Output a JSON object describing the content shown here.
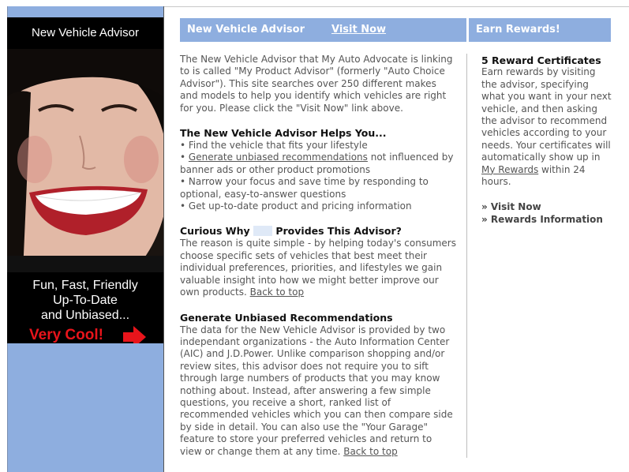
{
  "promo": {
    "title": "New Vehicle Advisor",
    "tagline_1": "Fun, Fast, Friendly",
    "tagline_2": "Up-To-Date",
    "tagline_3": "and Unbiased...",
    "cool": "Very Cool!"
  },
  "header": {
    "main_title": "New Vehicle Advisor",
    "visit_now": "Visit Now",
    "side_title": "Earn Rewards!"
  },
  "intro": "The New Vehicle Advisor that My Auto Advocate is linking to is called \"My Product Advisor\" (formerly \"Auto Choice Advisor\"). This site searches over 250 different makes and models to help you identify which vehicles are right for you. Please click the \"Visit Now\" link above.",
  "helps": {
    "heading": "The New Vehicle Advisor Helps You...",
    "b1": "• Find the vehicle that fits your lifestyle",
    "b2_prefix": "• ",
    "b2_link": "Generate unbiased recommendations",
    "b2_rest": " not influenced by banner ads or other product promotions",
    "b3": "• Narrow your focus and save time by responding to optional, easy-to-answer questions",
    "b4": "• Get up-to-date product and pricing information"
  },
  "curious": {
    "heading_a": "Curious Why",
    "heading_b": "Provides This Advisor?",
    "body": "The reason is quite simple - by helping today's consumers choose specific sets of vehicles that best meet their individual preferences, priorities, and lifestyles we gain valuable insight into how we might better improve our own products.",
    "back": "Back to top"
  },
  "generate": {
    "heading": "Generate Unbiased Recommendations",
    "body": "The data for the New Vehicle Advisor is provided by two independant organizations - the Auto Information Center (AIC) and J.D.Power. Unlike comparison shopping and/or review sites, this advisor does not require you to sift through large numbers of products that you may know nothing about. Instead, after answering a few simple questions, you receive a short, ranked list of recommended vehicles which you can then compare side by side in detail. You can also use the \"Your Garage\" feature to store your preferred vehicles and return to view or change them at any time.",
    "back": "Back to top"
  },
  "rewards": {
    "heading": "5 Reward Certificates",
    "body": "Earn rewards by visiting the advisor, specifying what you want in your next vehicle, and then asking the advisor to recommend vehicles according to your needs. Your certificates will automatically show up in ",
    "link": "My Rewards",
    "body_end": " within 24 hours.",
    "link_visit": "» Visit Now",
    "link_info": "» Rewards Information"
  },
  "colors": {
    "header_bg": "#8eaedf",
    "promo_bg": "#000000",
    "cool_red": "#e8141b"
  }
}
